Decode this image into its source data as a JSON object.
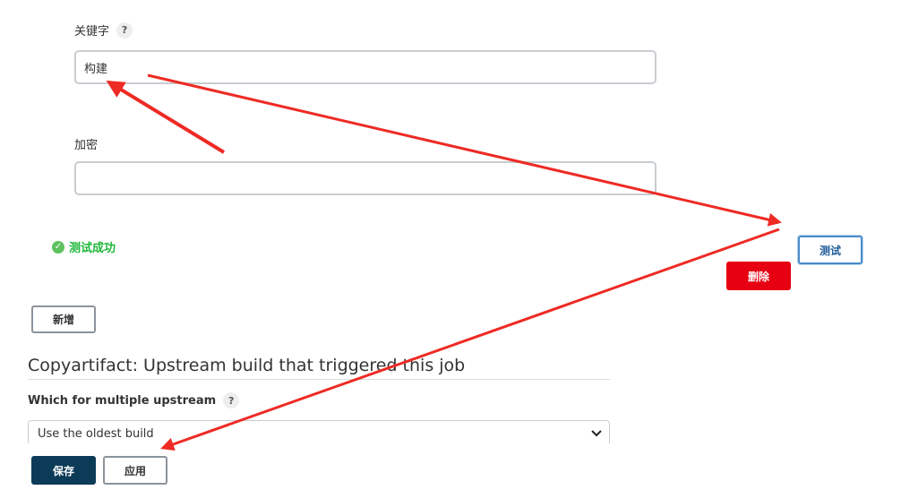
{
  "keyword": {
    "label": "关键字",
    "help": "?",
    "value": "构建"
  },
  "encryption": {
    "label": "加密",
    "value": ""
  },
  "status": {
    "message": "测试成功",
    "icon": "check-circle-icon",
    "color": "#1fb83a"
  },
  "buttons": {
    "test": "测试",
    "delete": "删除",
    "add": "新增",
    "save": "保存",
    "apply": "应用"
  },
  "copyartifact": {
    "title": "Copyartifact: Upstream build that triggered this job",
    "multiple_upstream_label": "Which for multiple upstream",
    "help": "?",
    "selected_option": "Use the oldest build"
  },
  "colors": {
    "annotation_arrow": "#ee2a24",
    "delete_red": "#e60012",
    "primary_navy": "#0c3b58"
  }
}
